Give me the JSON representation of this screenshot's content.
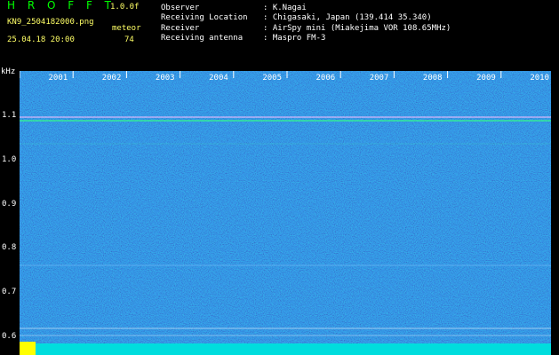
{
  "header": {
    "app_title": "H R O F F T",
    "version": "1.0.0f",
    "filename": "KN9_2504182000.png",
    "meteor_label": "meteor",
    "datetime": "25.04.18 20:00",
    "meteor_count": "74"
  },
  "info": [
    {
      "key": "Observer",
      "value": ": K.Nagai"
    },
    {
      "key": "Receiving Location",
      "value": ": Chigasaki, Japan (139.414 35.340)"
    },
    {
      "key": "Receiver",
      "value": ": AirSpy mini (Miakejima VOR 108.65MHz)"
    },
    {
      "key": "Receiving antenna",
      "value": ": Maspro FM-3"
    }
  ],
  "axis": {
    "y_unit": "kHz",
    "y_ticks": [
      "1.1",
      "1.0",
      "0.9",
      "0.8",
      "0.7",
      "0.6"
    ],
    "x_ticks": [
      "2001",
      "2002",
      "2003",
      "2004",
      "2005",
      "2006",
      "2007",
      "2008",
      "2009",
      "2010"
    ]
  },
  "colors": {
    "background": "#000000",
    "spectrogram_base": "#1a2aa0",
    "header_green": "#00ff00",
    "header_yellow": "#ffff66"
  }
}
